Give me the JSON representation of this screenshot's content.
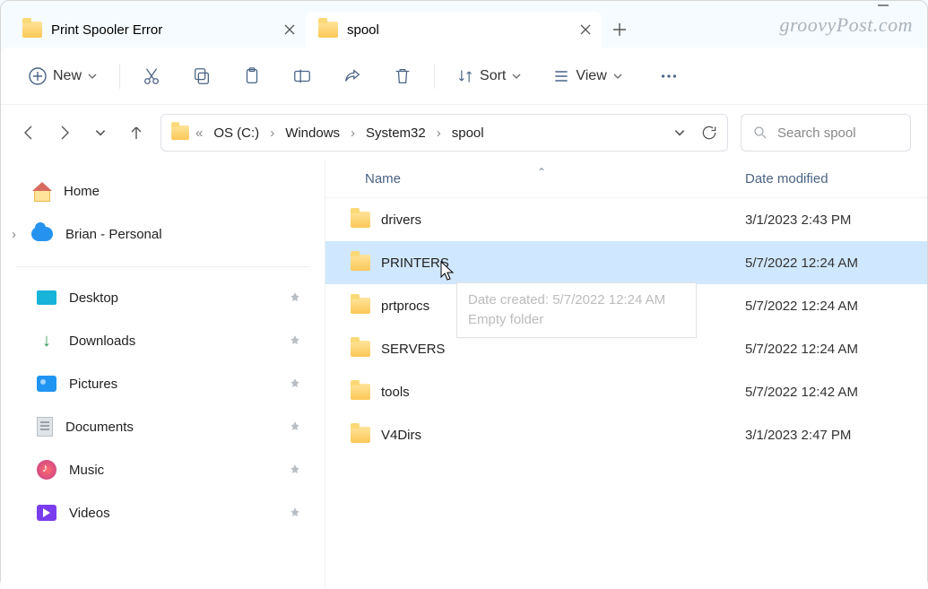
{
  "window": {
    "watermark": "groovyPost.com"
  },
  "tabs": [
    {
      "label": "Print Spooler Error",
      "active": false
    },
    {
      "label": "spool",
      "active": true
    }
  ],
  "toolbar": {
    "new_label": "New",
    "sort_label": "Sort",
    "view_label": "View"
  },
  "breadcrumb": {
    "drive": "OS (C:)",
    "parts": [
      "Windows",
      "System32",
      "spool"
    ],
    "ellipsis": "«"
  },
  "search": {
    "placeholder": "Search spool"
  },
  "sidebar": {
    "home": "Home",
    "onedrive": "Brian - Personal",
    "quick": [
      {
        "label": "Desktop",
        "icon": "desktop"
      },
      {
        "label": "Downloads",
        "icon": "downloads"
      },
      {
        "label": "Pictures",
        "icon": "pictures"
      },
      {
        "label": "Documents",
        "icon": "documents"
      },
      {
        "label": "Music",
        "icon": "music"
      },
      {
        "label": "Videos",
        "icon": "videos"
      }
    ]
  },
  "columns": {
    "name": "Name",
    "date": "Date modified"
  },
  "files": [
    {
      "name": "drivers",
      "date": "3/1/2023 2:43 PM",
      "selected": false
    },
    {
      "name": "PRINTERS",
      "date": "5/7/2022 12:24 AM",
      "selected": true
    },
    {
      "name": "prtprocs",
      "date": "5/7/2022 12:24 AM",
      "selected": false
    },
    {
      "name": "SERVERS",
      "date": "5/7/2022 12:24 AM",
      "selected": false
    },
    {
      "name": "tools",
      "date": "5/7/2022 12:42 AM",
      "selected": false
    },
    {
      "name": "V4Dirs",
      "date": "3/1/2023 2:47 PM",
      "selected": false
    }
  ],
  "tooltip": {
    "line1": "Date created: 5/7/2022 12:24 AM",
    "line2": "Empty folder"
  }
}
